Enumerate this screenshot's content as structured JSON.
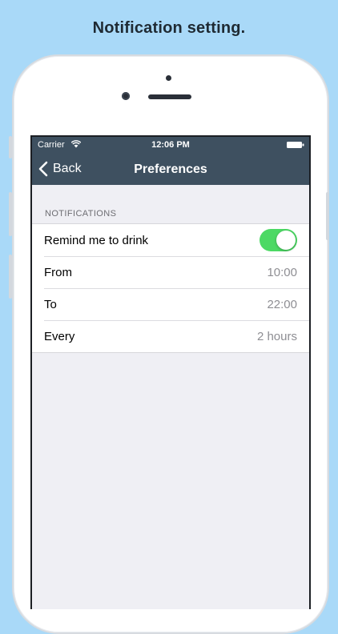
{
  "caption": "Notification setting.",
  "status_bar": {
    "carrier": "Carrier",
    "time": "12:06 PM",
    "wifi_icon": "wifi-icon",
    "battery_icon": "battery-icon"
  },
  "nav": {
    "back_label": "Back",
    "title": "Preferences"
  },
  "section": {
    "header": "NOTIFICATIONS"
  },
  "rows": [
    {
      "label": "Remind me to drink",
      "toggle": true
    },
    {
      "label": "From",
      "value": "10:00"
    },
    {
      "label": "To",
      "value": "22:00"
    },
    {
      "label": "Every",
      "value": "2 hours"
    }
  ],
  "colors": {
    "background": "#a9d9f8",
    "navbar": "#3e5060",
    "toggle_on": "#4cd964",
    "value_text": "#8e8e93"
  }
}
